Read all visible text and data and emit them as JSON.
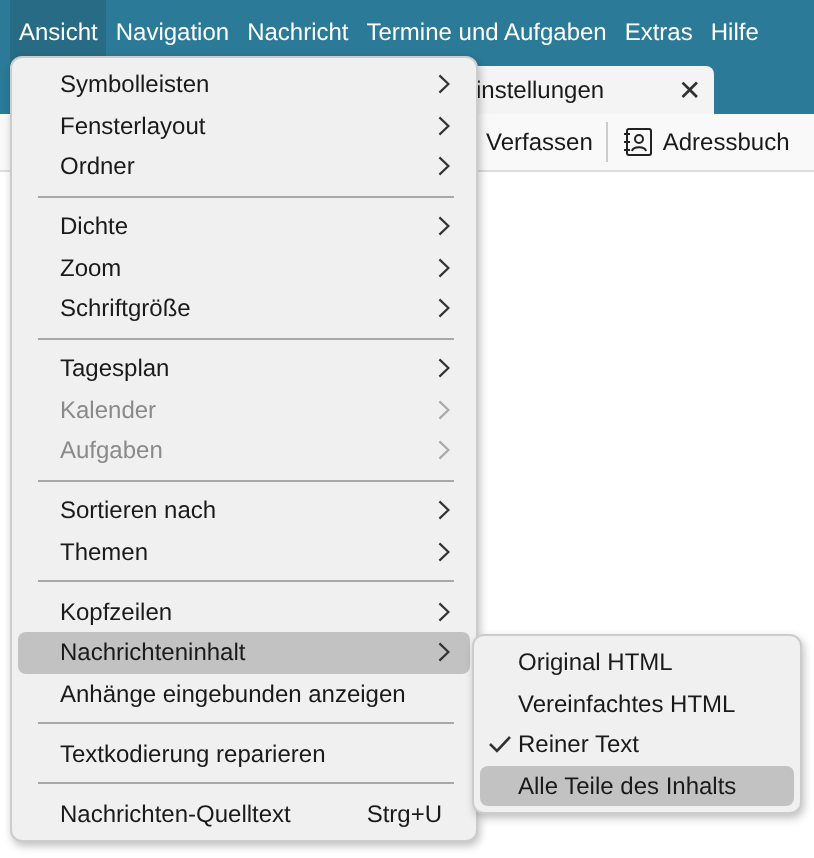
{
  "menubar": [
    {
      "label": "Ansicht",
      "selected": true
    },
    {
      "label": "Navigation",
      "selected": false
    },
    {
      "label": "Nachricht",
      "selected": false
    },
    {
      "label": "Termine und Aufgaben",
      "selected": false
    },
    {
      "label": "Extras",
      "selected": false
    },
    {
      "label": "Hilfe",
      "selected": false
    }
  ],
  "tab_strip": {
    "tab": {
      "label": "instellungen",
      "close": "✕"
    }
  },
  "toolbar": [
    {
      "label": "Verfassen",
      "icon": false
    },
    {
      "label": "Adressbuch",
      "icon": true
    }
  ],
  "menu": [
    {
      "kind": "item",
      "label": "Symbolleisten",
      "submenu": true,
      "disabled": false,
      "selected": false
    },
    {
      "kind": "item",
      "label": "Fensterlayout",
      "submenu": true,
      "disabled": false,
      "selected": false
    },
    {
      "kind": "item",
      "label": "Ordner",
      "submenu": true,
      "disabled": false,
      "selected": false
    },
    {
      "kind": "separator"
    },
    {
      "kind": "item",
      "label": "Dichte",
      "submenu": true,
      "disabled": false,
      "selected": false
    },
    {
      "kind": "item",
      "label": "Zoom",
      "submenu": true,
      "disabled": false,
      "selected": false
    },
    {
      "kind": "item",
      "label": "Schriftgröße",
      "submenu": true,
      "disabled": false,
      "selected": false
    },
    {
      "kind": "separator"
    },
    {
      "kind": "item",
      "label": "Tagesplan",
      "submenu": true,
      "disabled": false,
      "selected": false
    },
    {
      "kind": "item",
      "label": "Kalender",
      "submenu": true,
      "disabled": true,
      "selected": false
    },
    {
      "kind": "item",
      "label": "Aufgaben",
      "submenu": true,
      "disabled": true,
      "selected": false
    },
    {
      "kind": "separator"
    },
    {
      "kind": "item",
      "label": "Sortieren nach",
      "submenu": true,
      "disabled": false,
      "selected": false
    },
    {
      "kind": "item",
      "label": "Themen",
      "submenu": true,
      "disabled": false,
      "selected": false
    },
    {
      "kind": "separator"
    },
    {
      "kind": "item",
      "label": "Kopfzeilen",
      "submenu": true,
      "disabled": false,
      "selected": false
    },
    {
      "kind": "item",
      "label": "Nachrichteninhalt",
      "submenu": true,
      "disabled": false,
      "selected": true
    },
    {
      "kind": "item",
      "label": "Anhänge eingebunden anzeigen",
      "submenu": false,
      "disabled": false,
      "selected": false
    },
    {
      "kind": "separator"
    },
    {
      "kind": "item",
      "label": "Textkodierung reparieren",
      "submenu": false,
      "disabled": false,
      "selected": false
    },
    {
      "kind": "separator"
    },
    {
      "kind": "item",
      "label": "Nachrichten-Quelltext",
      "submenu": false,
      "disabled": false,
      "selected": false,
      "shortcut": "Strg+U"
    }
  ],
  "submenu": [
    {
      "label": "Original HTML",
      "checked": false,
      "selected": false
    },
    {
      "label": "Vereinfachtes HTML",
      "checked": false,
      "selected": false
    },
    {
      "label": "Reiner Text",
      "checked": true,
      "selected": false
    },
    {
      "label": "Alle Teile des Inhalts",
      "checked": false,
      "selected": true
    }
  ]
}
